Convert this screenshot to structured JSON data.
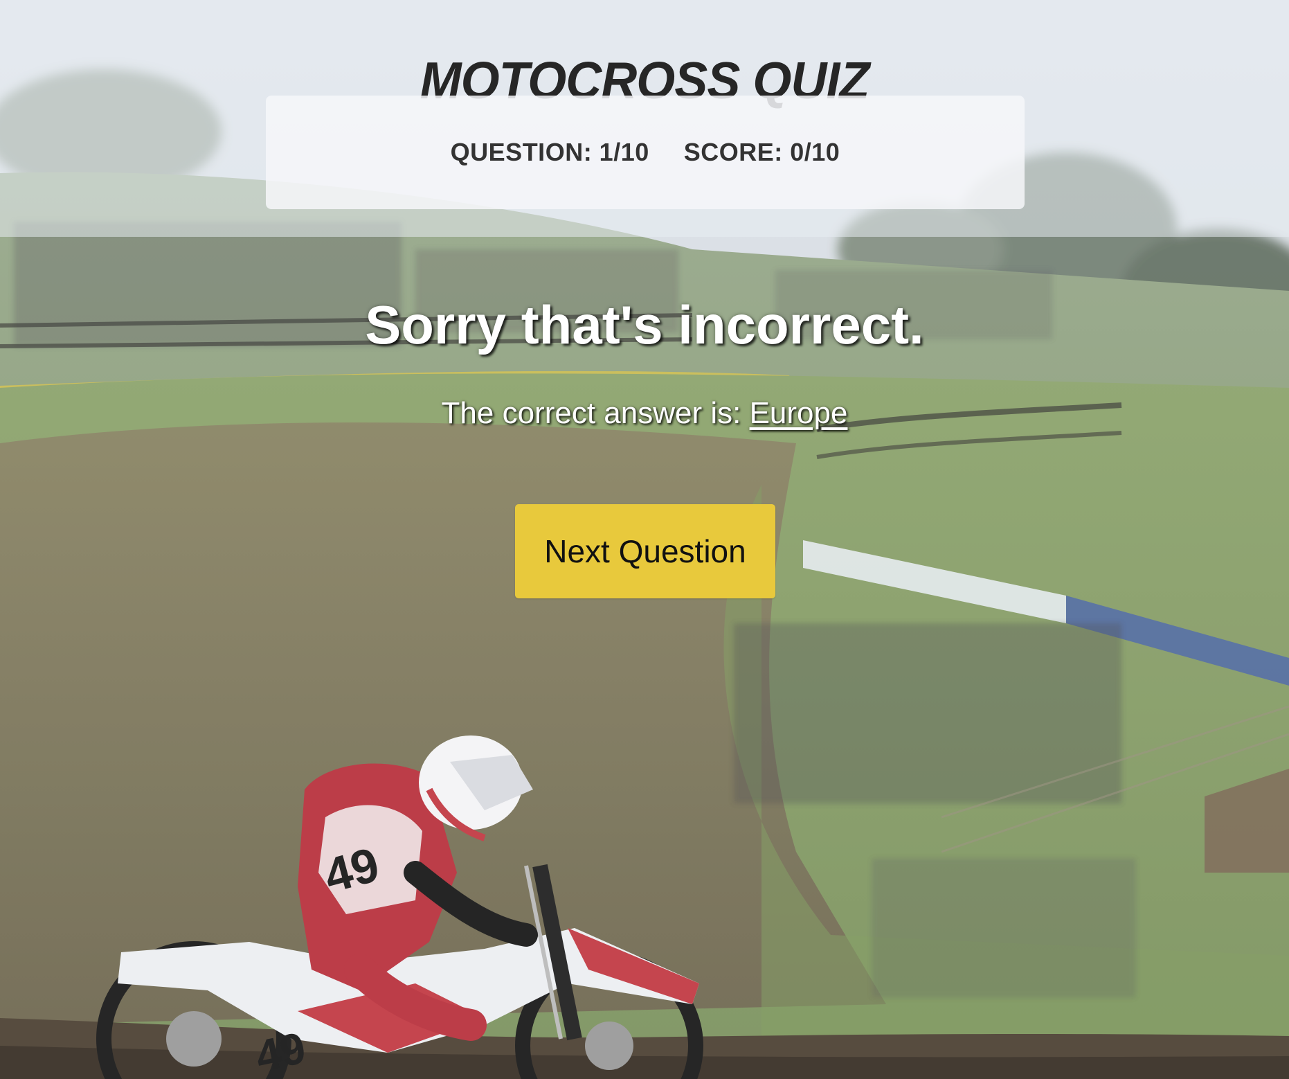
{
  "header": {
    "title": "MOTOCROSS QUIZ",
    "question_label": "QUESTION: 1/10",
    "score_label": "SCORE: 0/10"
  },
  "result": {
    "heading": "Sorry that's incorrect.",
    "answer_prefix": "The correct answer is: ",
    "answer_value": "Europe"
  },
  "actions": {
    "next_label": "Next Question"
  },
  "background": {
    "description_icon": "motocross-photo",
    "rider_number": "49"
  },
  "colors": {
    "button": "#e8c93c",
    "title": "#262626",
    "grass": "#7f9a5f",
    "dirt": "#6b5a48"
  }
}
